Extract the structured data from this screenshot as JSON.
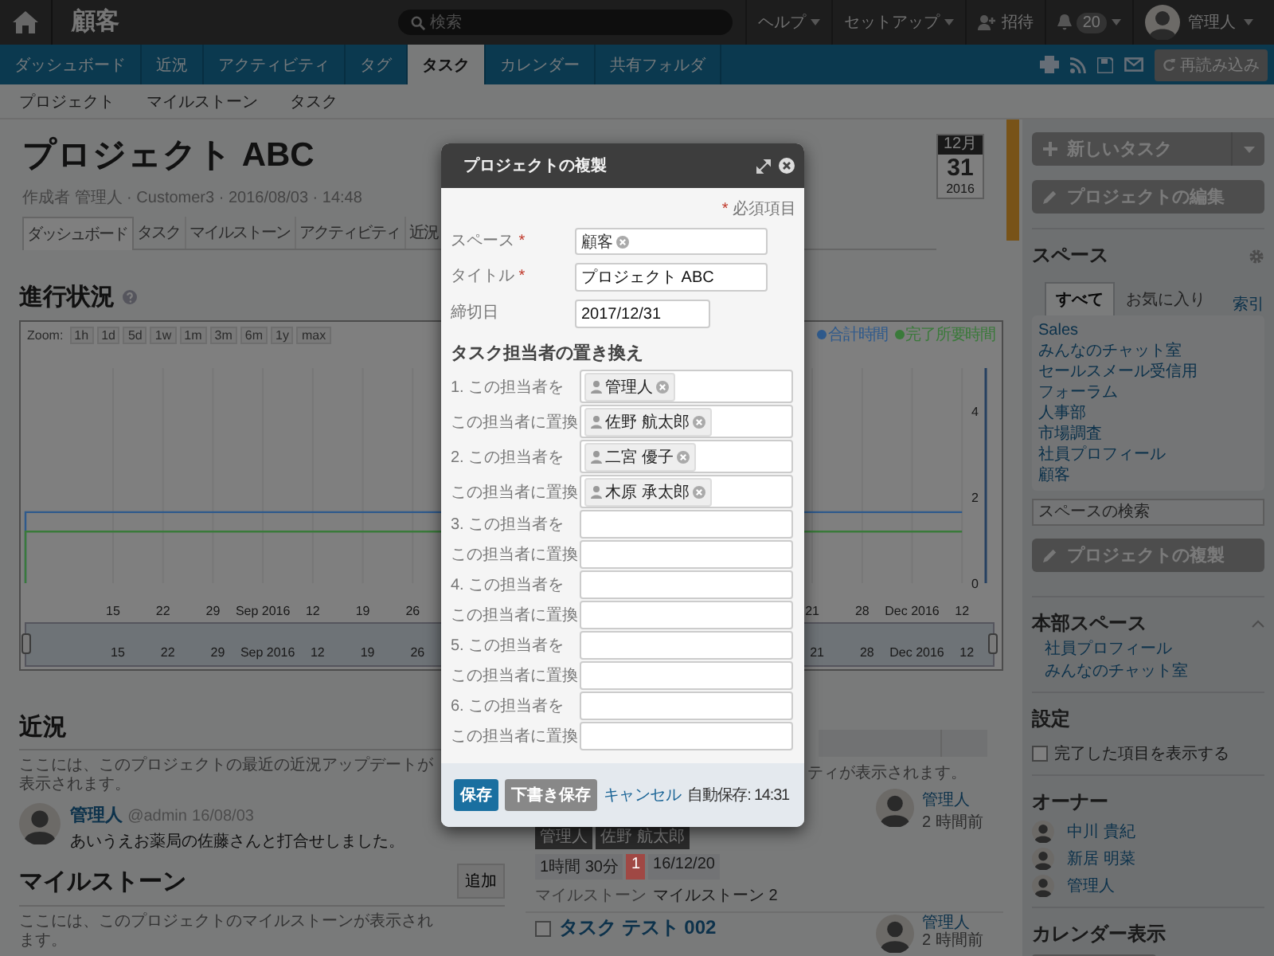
{
  "topbar": {
    "space": "顧客",
    "search": {
      "placeholder": "検索"
    },
    "menus": [
      "ヘルプ",
      "セットアップ"
    ],
    "invite": "招待",
    "notifications": "20",
    "user": "管理人"
  },
  "nav": {
    "tabs": [
      {
        "label": "ダッシュボード",
        "selected": false
      },
      {
        "label": "近況",
        "selected": false
      },
      {
        "label": "アクティビティ",
        "selected": false
      },
      {
        "label": "タグ",
        "selected": false
      },
      {
        "label": "タスク",
        "selected": true
      },
      {
        "label": "カレンダー",
        "selected": false
      },
      {
        "label": "共有フォルダ",
        "selected": false
      }
    ],
    "reload": "再読み込み"
  },
  "subnav": [
    "プロジェクト",
    "マイルストーン",
    "タスク"
  ],
  "project": {
    "title": "プロジェクト ABC",
    "meta": "作成者 管理人 · Customer3 · 2016/08/03 · 14:48",
    "tabs": [
      {
        "label": "ダッシュボード",
        "selected": true
      },
      {
        "label": "タスク",
        "selected": false
      },
      {
        "label": "マイルストーン",
        "selected": false
      },
      {
        "label": "アクティビティ",
        "selected": false
      },
      {
        "label": "近況",
        "selected": false
      }
    ],
    "due": {
      "month": "12月",
      "day": "31",
      "year": "2016"
    }
  },
  "progress": {
    "title": "進行状況",
    "zoom_label": "Zoom:",
    "zoom": [
      "1h",
      "1d",
      "5d",
      "1w",
      "1m",
      "3m",
      "6m",
      "1y",
      "max"
    ],
    "chart_data": {
      "type": "line",
      "ylim": [
        0,
        5
      ],
      "yticks": [
        0,
        2,
        4
      ],
      "grid": true,
      "legend": true,
      "categories": [
        "15",
        "22",
        "29",
        "Sep 2016",
        "12",
        "19",
        "26",
        null,
        null,
        null,
        null,
        null,
        null,
        null,
        "21",
        "28",
        "Dec 2016",
        "12"
      ],
      "series": [
        {
          "name": "合計時間",
          "color": "#2f5a8c",
          "values": [
            1.65,
            1.65,
            1.65,
            1.65,
            1.65,
            1.65,
            1.65,
            null,
            null,
            null,
            null,
            null,
            null,
            null,
            1.65,
            1.65,
            1.65,
            1.65
          ]
        },
        {
          "name": "完了所要時間",
          "color": "#3a7a3a",
          "values": [
            1.2,
            1.2,
            1.2,
            1.2,
            1.2,
            1.2,
            1.2,
            null,
            null,
            null,
            null,
            null,
            null,
            null,
            1.2,
            1.2,
            1.2,
            1.2
          ]
        }
      ]
    },
    "navigator_labels": [
      "15",
      "22",
      "29",
      "Sep 2016",
      "12",
      "19",
      "26",
      "21",
      "28",
      "Dec 2016",
      "12"
    ]
  },
  "updates": {
    "title": "近況",
    "description": "ここには、このプロジェクトの最近の近況アップデートが表示されます。",
    "posts": [
      {
        "author": "管理人",
        "handle": "@admin",
        "date": "16/08/03",
        "text": "あいうえお薬局の佐藤さんと打合せしました。"
      }
    ]
  },
  "milestones": {
    "title": "マイルストーン",
    "add": "追加",
    "description": "ここには、このプロジェクトのマイルストーンが表示されます。"
  },
  "activity": {
    "description_end": "ティが表示されます。",
    "tasks": [
      {
        "assignees": [
          "管理人",
          "佐野 航太郎"
        ],
        "estimate": "1時間 30分",
        "priority": "1",
        "color": "#a04844",
        "due": "16/12/20",
        "milestone_label": "マイルストーン",
        "milestone": "マイルストーン 2",
        "owner": "管理人",
        "time": "2 時間前"
      },
      {
        "title": "タスク テスト 002",
        "done": false,
        "owner": "管理人",
        "time": "2 時間前"
      }
    ]
  },
  "sidebar": {
    "new_task": "新しいタスク",
    "edit": "プロジェクトの編集",
    "spaces": {
      "title": "スペース",
      "tabs": [
        {
          "label": "すべて",
          "selected": true
        },
        {
          "label": "お気に入り",
          "selected": false
        }
      ],
      "index": "索引",
      "items": [
        "Sales",
        "みんなのチャット室",
        "セールスメール受信用",
        "フォーラム",
        "人事部",
        "市場調査",
        "社員プロフィール",
        "顧客"
      ],
      "search_placeholder": "スペースの検索"
    },
    "duplicate": "プロジェクトの複製",
    "hq": {
      "title": "本部スペース",
      "expanded": true,
      "items": [
        "社員プロフィール",
        "みんなのチャット室"
      ]
    },
    "settings": {
      "title": "設定",
      "options": [
        {
          "label": "完了した項目を表示する",
          "checked": false
        }
      ]
    },
    "owners": {
      "title": "オーナー",
      "people": [
        "中川 貴紀",
        "新居 明菜",
        "管理人"
      ]
    },
    "calendar": {
      "title": "カレンダー表示"
    }
  },
  "modal": {
    "title": "プロジェクトの複製",
    "required_mark": "*",
    "required_note": "必須項目",
    "fields": [
      {
        "label": "スペース",
        "mark": "*",
        "kind": "token",
        "value": "顧客"
      },
      {
        "label": "タイトル",
        "mark": "*",
        "kind": "text",
        "value": "プロジェクト ABC"
      },
      {
        "label": "締切日",
        "kind": "date",
        "value": "2017/12/31"
      }
    ],
    "assignee_title": "タスク担当者の置き換え",
    "rows": [
      {
        "label": "1. この担当者を",
        "token": "管理人"
      },
      {
        "label": "この担当者に置換",
        "token": "佐野 航太郎"
      },
      {
        "label": "2. この担当者を",
        "token": "二宮 優子"
      },
      {
        "label": "この担当者に置換",
        "token": "木原 承太郎"
      },
      {
        "label": "3. この担当者を"
      },
      {
        "label": "この担当者に置換"
      },
      {
        "label": "4. この担当者を"
      },
      {
        "label": "この担当者に置換"
      },
      {
        "label": "5. この担当者を"
      },
      {
        "label": "この担当者に置換"
      },
      {
        "label": "6. この担当者を"
      },
      {
        "label": "この担当者に置換"
      }
    ],
    "save": "保存",
    "draft": "下書き保存",
    "cancel": "キャンセル",
    "autosave": "自動保存: 14:31"
  }
}
